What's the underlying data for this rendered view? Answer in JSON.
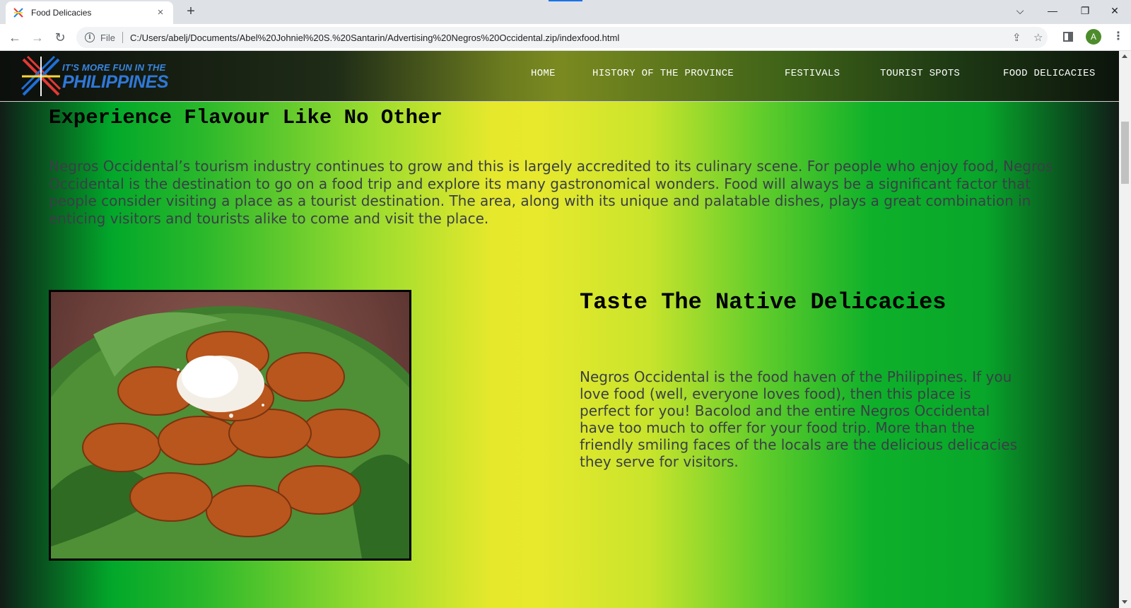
{
  "browser": {
    "tab_title": "Food Delicacies",
    "tab_close": "×",
    "new_tab": "+",
    "scheme_label": "File",
    "url": "C:/Users/abelj/Documents/Abel%20Johniel%20S.%20Santarin/Advertising%20Negros%20Occidental.zip/indexfood.html",
    "profile_initial": "A",
    "window_controls": {
      "tab_search": "⌵",
      "minimize": "—",
      "restore": "❐",
      "close": "✕"
    },
    "nav_icons": {
      "back": "←",
      "forward": "→",
      "reload": "↻",
      "share": "⇪",
      "bookmark": "☆",
      "menu": "⋮"
    }
  },
  "site": {
    "logo": {
      "line1": "IT'S MORE FUN IN THE",
      "line2": "PHILIPPINES"
    },
    "nav": [
      {
        "label": "HOME"
      },
      {
        "label": "HISTORY OF THE PROVINCE"
      },
      {
        "label": "FESTIVALS"
      },
      {
        "label": "TOURIST SPOTS"
      },
      {
        "label": "FOOD DELICACIES"
      }
    ]
  },
  "content": {
    "heading": "Experience Flavour Like No Other",
    "intro": "Negros Occidental’s tourism industry continues to grow and this is largely accredited to its culinary scene. For people who enjoy food, Negros Occidental is the destination to go on a food trip and explore its many gastronomical wonders. Food will always be a significant factor that people consider visiting a place as a tourist destination. The area, along with its unique and palatable dishes, plays a great combination in enticing visitors and tourists alike to come and visit the place.",
    "subheading": "Taste The Native Delicacies",
    "sub_text": "Negros Occidental is the food haven of the Philippines. If you love food (well, everyone loves food), then this place is perfect for you! Bacolod and the entire Negros Occidental have too much to offer for your food trip. More than the friendly smiling faces of the locals are the delicious delicacies they serve for visitors."
  },
  "colors": {
    "chrome_bg": "#dee1e6",
    "accent": "#1a73e8",
    "avatar_bg": "#4d8c2b",
    "page_green": "#08a62a",
    "page_yellow": "#e8e92d"
  }
}
